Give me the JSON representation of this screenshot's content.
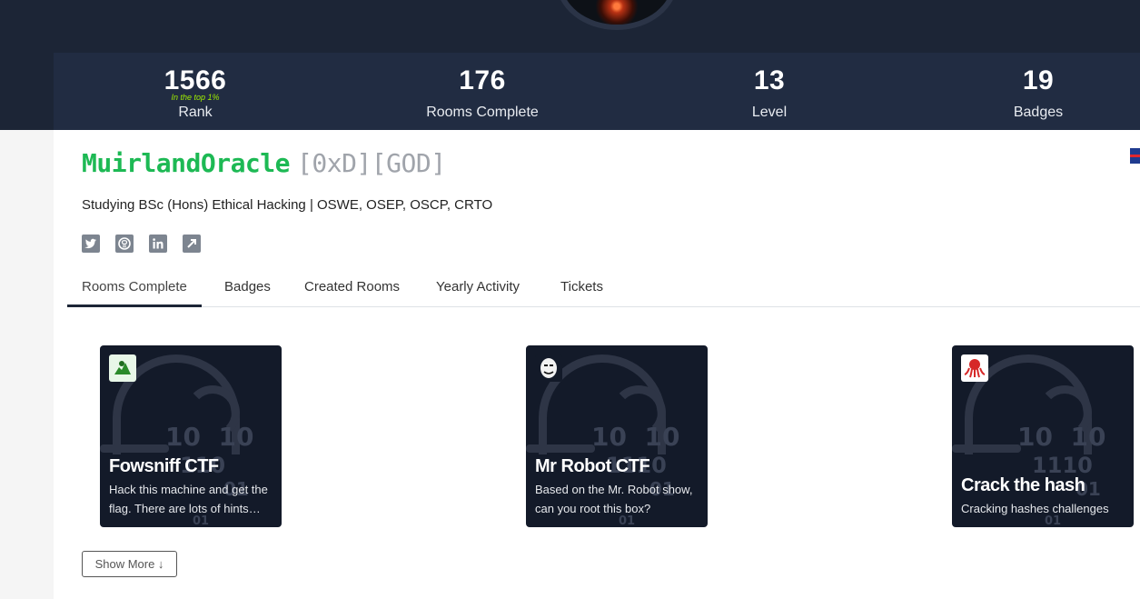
{
  "stats": [
    {
      "value": "1566",
      "label": "Rank",
      "sub": "In the top 1%"
    },
    {
      "value": "176",
      "label": "Rooms Complete"
    },
    {
      "value": "13",
      "label": "Level"
    },
    {
      "value": "19",
      "label": "Badges"
    }
  ],
  "profile": {
    "username": "MuirlandOracle",
    "titles": "[0xD][GOD]",
    "bio": "Studying BSc (Hons) Ethical Hacking | OSWE, OSEP, OSCP, CRTO",
    "social_icons": [
      "twitter-icon",
      "github-icon",
      "linkedin-icon",
      "external-link-icon"
    ]
  },
  "tabs": [
    "Rooms Complete",
    "Badges",
    "Created Rooms",
    "Yearly Activity",
    "Tickets"
  ],
  "active_tab": "Rooms Complete",
  "rooms": [
    {
      "title": "Fowsniff CTF",
      "description": "Hack this machine and get the flag. There are lots of hints along the way",
      "icon": "green-hacker-icon"
    },
    {
      "title": "Mr Robot CTF",
      "description": "Based on the Mr. Robot show, can you root this box?",
      "icon": "mask-icon"
    },
    {
      "title": "Crack the hash",
      "description": "Cracking hashes challenges",
      "icon": "octopus-icon"
    }
  ],
  "show_more_label": "Show More ↓",
  "colors": {
    "accent_green": "#1db954",
    "rank_sub": "#9fef00",
    "dark_bg": "#1c2536",
    "card_bg": "#131a29"
  }
}
